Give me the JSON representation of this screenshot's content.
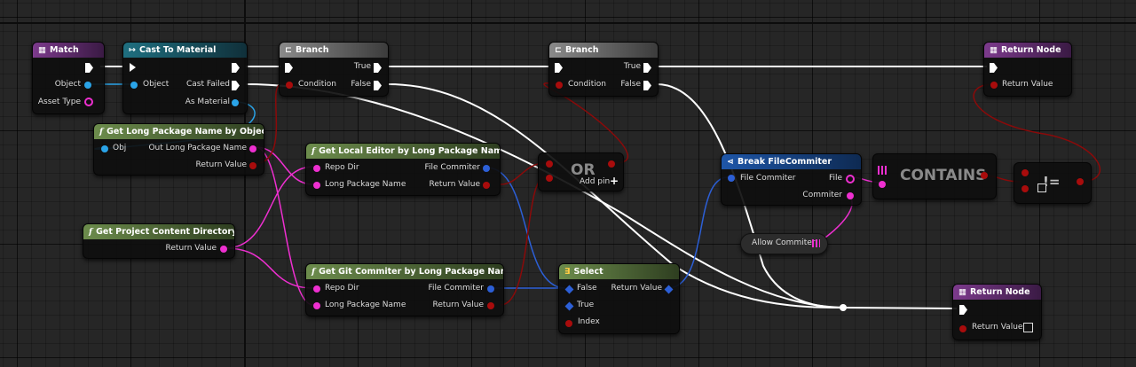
{
  "nodes": {
    "match": {
      "title": "Match",
      "object": "Object",
      "asset_type": "Asset Type"
    },
    "cast_to_material": {
      "title": "Cast To Material",
      "object": "Object",
      "cast_failed": "Cast Failed",
      "as_material": "As Material"
    },
    "branch1": {
      "title": "Branch",
      "condition": "Condition",
      "true": "True",
      "false": "False"
    },
    "branch2": {
      "title": "Branch",
      "condition": "Condition",
      "true": "True",
      "false": "False"
    },
    "return_node_top": {
      "title": "Return Node",
      "return_value": "Return Value"
    },
    "get_long_package_name": {
      "title": "Get Long Package Name by Object",
      "obj": "Obj",
      "out_long_package_name": "Out Long Package Name",
      "return_value": "Return Value"
    },
    "get_local_editor": {
      "title": "Get Local Editor by Long Package Name",
      "repo_dir": "Repo Dir",
      "long_package_name": "Long Package Name",
      "file_commiter": "File Commiter",
      "return_value": "Return Value"
    },
    "or_node": {
      "title": "OR",
      "add_pin": "Add pin",
      "add_glyph": "+"
    },
    "break_file_commiter": {
      "title": "Break FileCommiter",
      "file_commiter": "File Commiter",
      "file": "File",
      "commiter": "Commiter"
    },
    "contains": {
      "title": "CONTAINS"
    },
    "not_equal": {
      "title": "!="
    },
    "get_project_content_directory": {
      "title": "Get Project Content Directory",
      "return_value": "Return Value"
    },
    "allow_commiter": {
      "title": "Allow Commiter"
    },
    "get_git_commiter": {
      "title": "Get Git Commiter by Long Package Name",
      "repo_dir": "Repo Dir",
      "long_package_name": "Long Package Name",
      "file_commiter": "File Commiter",
      "return_value": "Return Value"
    },
    "select": {
      "title": "Select",
      "false": "False",
      "true": "True",
      "index": "Index",
      "return_value": "Return Value"
    },
    "return_node_bottom": {
      "title": "Return Node",
      "return_value": "Return Value"
    }
  },
  "icons": {
    "function": "f",
    "cast": "↦",
    "branch": "⊏",
    "break": "⋖",
    "select": "∃"
  },
  "colors": {
    "exec": "#ffffff",
    "object_pin": "#2aa4e8",
    "string_pin": "#ee2fd0",
    "bool_pin": "#a80c0c",
    "struct_pin": "#2c5fd6"
  }
}
